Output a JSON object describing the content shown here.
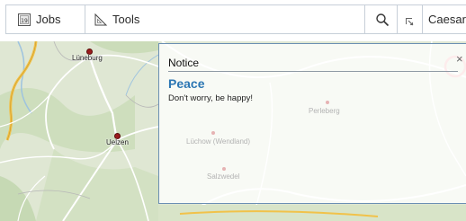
{
  "toolbar": {
    "jobs_label": "Jobs",
    "tools_label": "Tools",
    "user_label": "Caesar",
    "icons": [
      "jobs-icon",
      "tools-icon",
      "search-icon",
      "expand-icon"
    ]
  },
  "map": {
    "places": [
      {
        "name": "Lüneburg"
      },
      {
        "name": "Uelzen"
      }
    ],
    "faded_places": [
      {
        "name": "Perleberg"
      },
      {
        "name": "Lüchow (Wendland)"
      },
      {
        "name": "Salzwedel"
      }
    ]
  },
  "notice": {
    "title": "Notice",
    "heading": "Peace",
    "message": "Don't worry, be happy!",
    "close_symbol": "×"
  }
}
